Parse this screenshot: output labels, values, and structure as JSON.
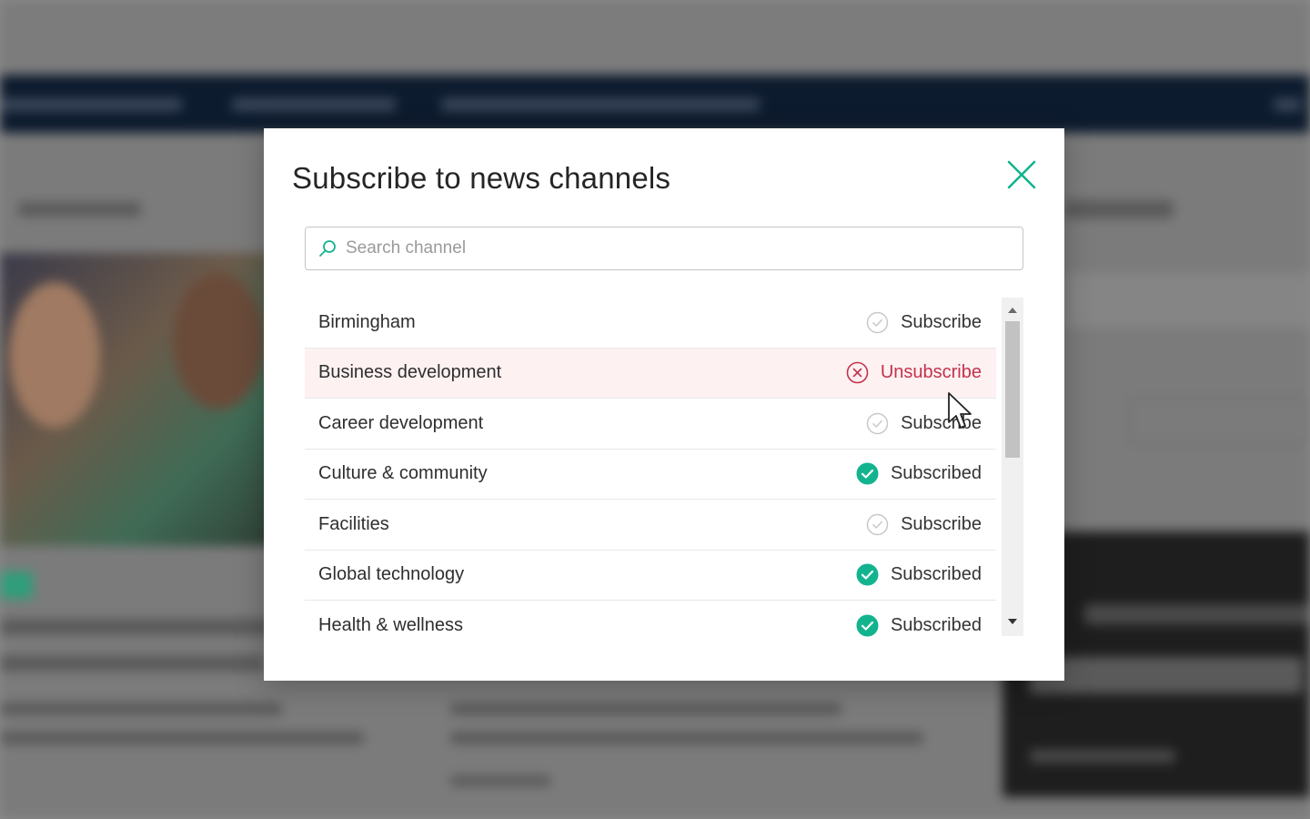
{
  "colors": {
    "accent": "#13b38f",
    "danger": "#c4314b",
    "hover_row": "#fdf1f2"
  },
  "dialog": {
    "title": "Subscribe to news channels",
    "close_icon": "close-icon"
  },
  "search": {
    "placeholder": "Search channel",
    "value": ""
  },
  "channels": [
    {
      "name": "Birmingham",
      "action": "Subscribe",
      "state": "unsubscribed"
    },
    {
      "name": "Business development",
      "action": "Unsubscribe",
      "state": "hover-unsubscribe"
    },
    {
      "name": "Career development",
      "action": "Subscribe",
      "state": "unsubscribed"
    },
    {
      "name": "Culture & community",
      "action": "Subscribed",
      "state": "subscribed"
    },
    {
      "name": "Facilities",
      "action": "Subscribe",
      "state": "unsubscribed"
    },
    {
      "name": "Global technology",
      "action": "Subscribed",
      "state": "subscribed"
    },
    {
      "name": "Health & wellness",
      "action": "Subscribed",
      "state": "subscribed"
    }
  ]
}
